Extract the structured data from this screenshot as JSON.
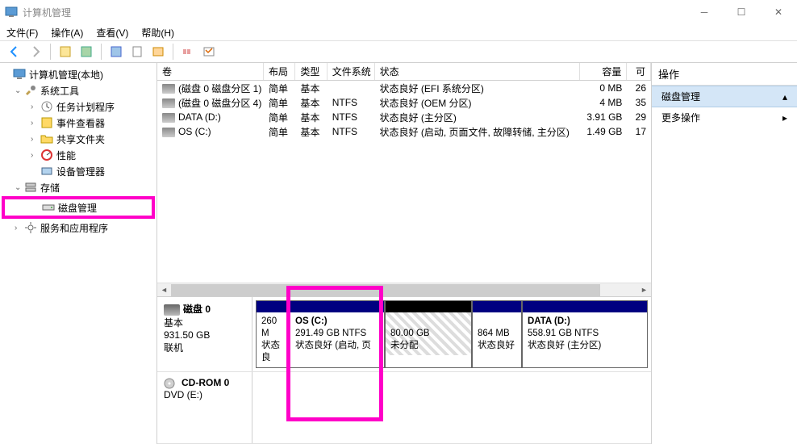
{
  "window": {
    "title": "计算机管理"
  },
  "menu": {
    "file": "文件(F)",
    "action": "操作(A)",
    "view": "查看(V)",
    "help": "帮助(H)"
  },
  "tree": {
    "root": "计算机管理(本地)",
    "system_tools": "系统工具",
    "task_scheduler": "任务计划程序",
    "event_viewer": "事件查看器",
    "shared_folders": "共享文件夹",
    "performance": "性能",
    "device_manager": "设备管理器",
    "storage": "存储",
    "disk_management": "磁盘管理",
    "services": "服务和应用程序"
  },
  "vol_headers": {
    "volume": "卷",
    "layout": "布局",
    "type": "类型",
    "fs": "文件系统",
    "status": "状态",
    "capacity": "容量",
    "free": "可"
  },
  "volumes": [
    {
      "name": "(磁盘 0 磁盘分区 1)",
      "layout": "简单",
      "type": "基本",
      "fs": "",
      "status": "状态良好 (EFI 系统分区)",
      "cap": "0 MB",
      "free": "26"
    },
    {
      "name": "(磁盘 0 磁盘分区 4)",
      "layout": "简单",
      "type": "基本",
      "fs": "NTFS",
      "status": "状态良好 (OEM 分区)",
      "cap": "4 MB",
      "free": "35"
    },
    {
      "name": "DATA (D:)",
      "layout": "简单",
      "type": "基本",
      "fs": "NTFS",
      "status": "状态良好 (主分区)",
      "cap": "3.91 GB",
      "free": "29"
    },
    {
      "name": "OS (C:)",
      "layout": "简单",
      "type": "基本",
      "fs": "NTFS",
      "status": "状态良好 (启动, 页面文件, 故障转储, 主分区)",
      "cap": "1.49 GB",
      "free": "17"
    }
  ],
  "disk0": {
    "title": "磁盘 0",
    "type": "基本",
    "size": "931.50 GB",
    "status": "联机",
    "parts": [
      {
        "title": "",
        "line1": "260 M",
        "line2": "状态良"
      },
      {
        "title": "OS  (C:)",
        "line1": "291.49 GB NTFS",
        "line2": "状态良好 (启动, 页"
      },
      {
        "title": "",
        "line1": "80.00 GB",
        "line2": "未分配"
      },
      {
        "title": "",
        "line1": "864 MB",
        "line2": "状态良好"
      },
      {
        "title": "DATA  (D:)",
        "line1": "558.91 GB NTFS",
        "line2": "状态良好 (主分区)"
      }
    ]
  },
  "cdrom": {
    "title": "CD-ROM 0",
    "line": "DVD (E:)"
  },
  "actions": {
    "header": "操作",
    "disk_mgmt": "磁盘管理",
    "more": "更多操作"
  }
}
